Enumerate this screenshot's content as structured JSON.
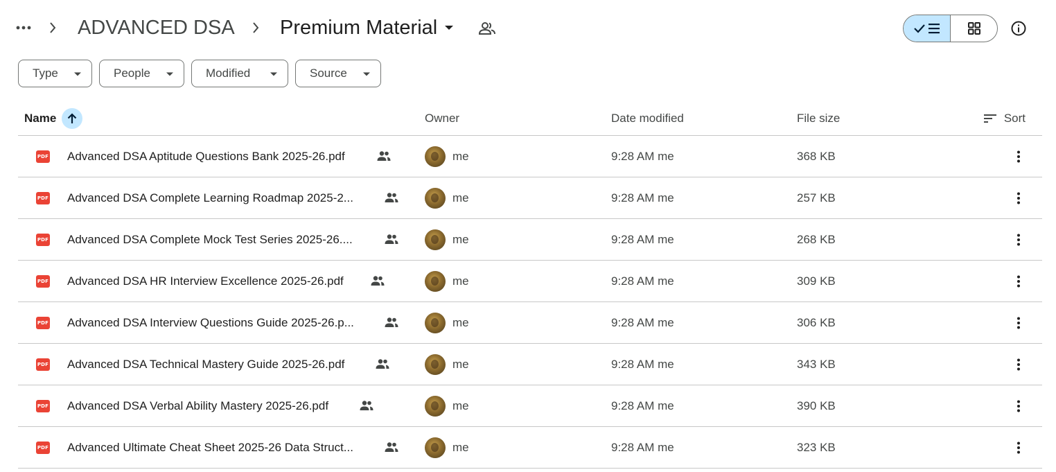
{
  "breadcrumb": {
    "parent": "ADVANCED DSA",
    "current": "Premium Material"
  },
  "filters": [
    {
      "label": "Type"
    },
    {
      "label": "People"
    },
    {
      "label": "Modified"
    },
    {
      "label": "Source"
    }
  ],
  "columns": {
    "name": "Name",
    "owner": "Owner",
    "modified": "Date modified",
    "size": "File size",
    "sort": "Sort"
  },
  "icon_badge": "PDF",
  "colors": {
    "accent": "#c2e7ff",
    "pdf_red": "#ea4335",
    "border": "#747775"
  },
  "files": [
    {
      "name": "Advanced DSA Aptitude Questions Bank 2025-26.pdf",
      "owner": "me",
      "modified": "9:28 AM me",
      "size": "368 KB"
    },
    {
      "name": "Advanced DSA Complete Learning Roadmap 2025-2...",
      "owner": "me",
      "modified": "9:28 AM me",
      "size": "257 KB"
    },
    {
      "name": "Advanced DSA Complete Mock Test Series 2025-26....",
      "owner": "me",
      "modified": "9:28 AM me",
      "size": "268 KB"
    },
    {
      "name": "Advanced DSA HR Interview Excellence 2025-26.pdf",
      "owner": "me",
      "modified": "9:28 AM me",
      "size": "309 KB"
    },
    {
      "name": "Advanced DSA Interview Questions Guide 2025-26.p...",
      "owner": "me",
      "modified": "9:28 AM me",
      "size": "306 KB"
    },
    {
      "name": "Advanced DSA Technical Mastery Guide 2025-26.pdf",
      "owner": "me",
      "modified": "9:28 AM me",
      "size": "343 KB"
    },
    {
      "name": "Advanced DSA Verbal Ability Mastery 2025-26.pdf",
      "owner": "me",
      "modified": "9:28 AM me",
      "size": "390 KB"
    },
    {
      "name": "Advanced Ultimate Cheat Sheet 2025-26 Data Struct...",
      "owner": "me",
      "modified": "9:28 AM me",
      "size": "323 KB"
    }
  ]
}
